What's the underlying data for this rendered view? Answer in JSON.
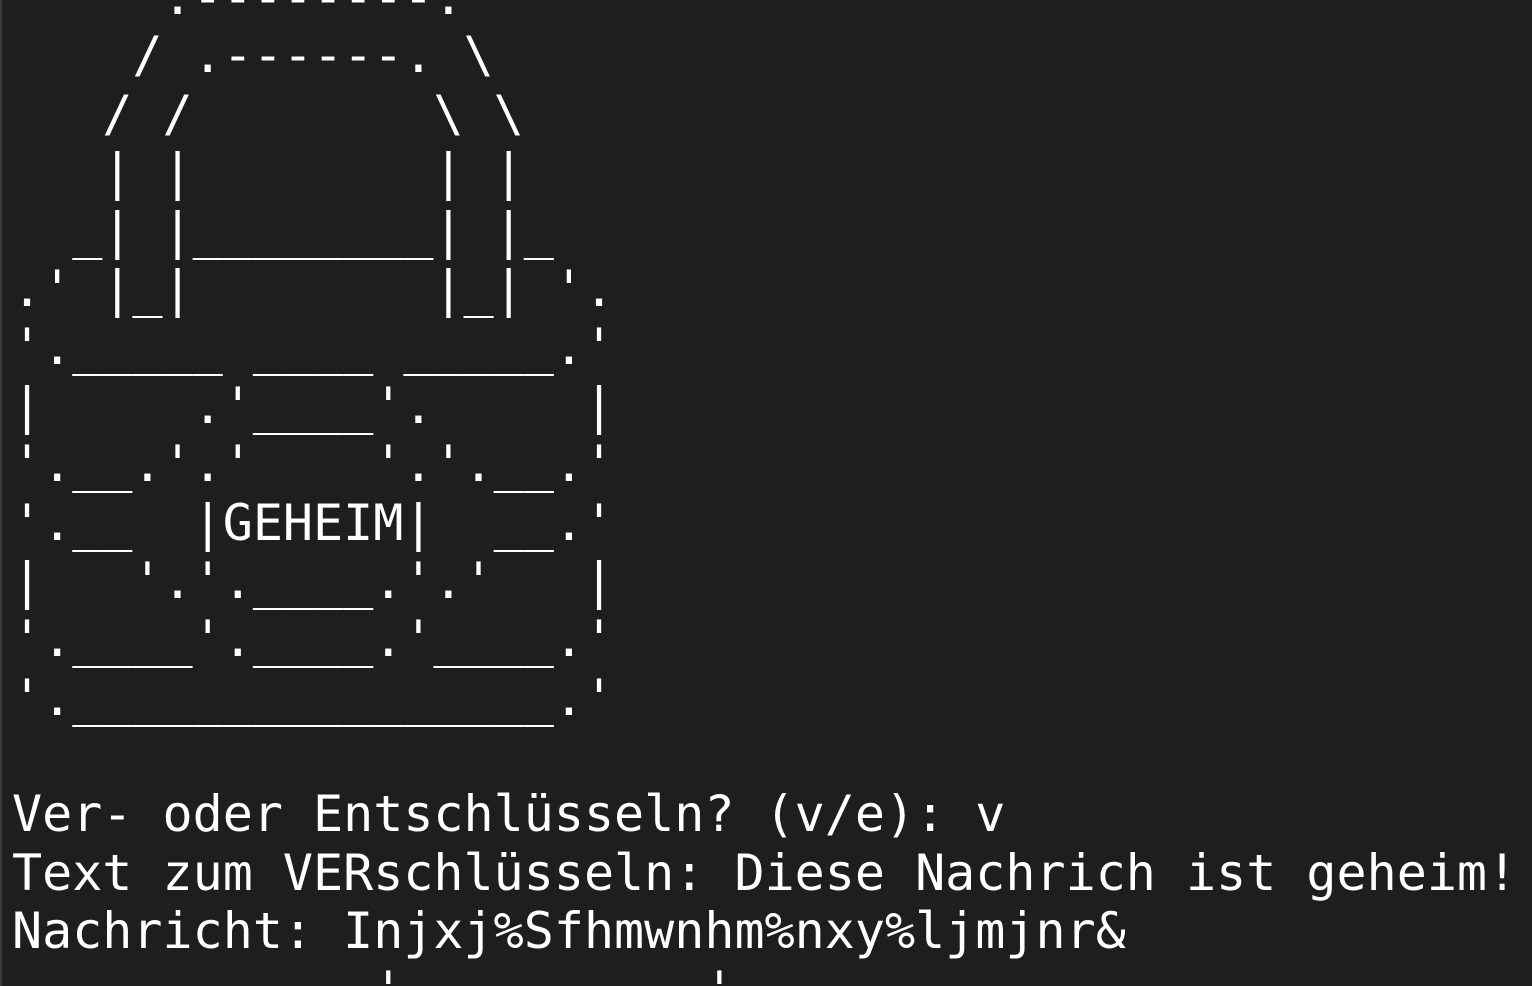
{
  "terminal": {
    "art": [
      "     .--------.",
      "    / .------. \\",
      "   / /        \\ \\",
      "   | |        | |",
      "  _| |________| |_",
      ".' |_|        |_| '.",
      "'._____ ____ _____.'",
      "|     .'____'.     |",
      "'.__.'.'    '.'.__.'",
      "'.__  |GEHEIM|  __.'",
      "|   '.'.____.'.'   |",
      "'.____'.____.'____.'",
      "'.________________.'",
      ""
    ],
    "prompt_mode": "Ver- oder Entschlüsseln? (v/e): v",
    "prompt_text": "Text zum VERschlüsseln: Diese Nachrich ist geheim!",
    "output": "Nachricht: Injxj%Sfhmwnhm%nxy%ljmjnr&",
    "next_line": "            '          '"
  }
}
